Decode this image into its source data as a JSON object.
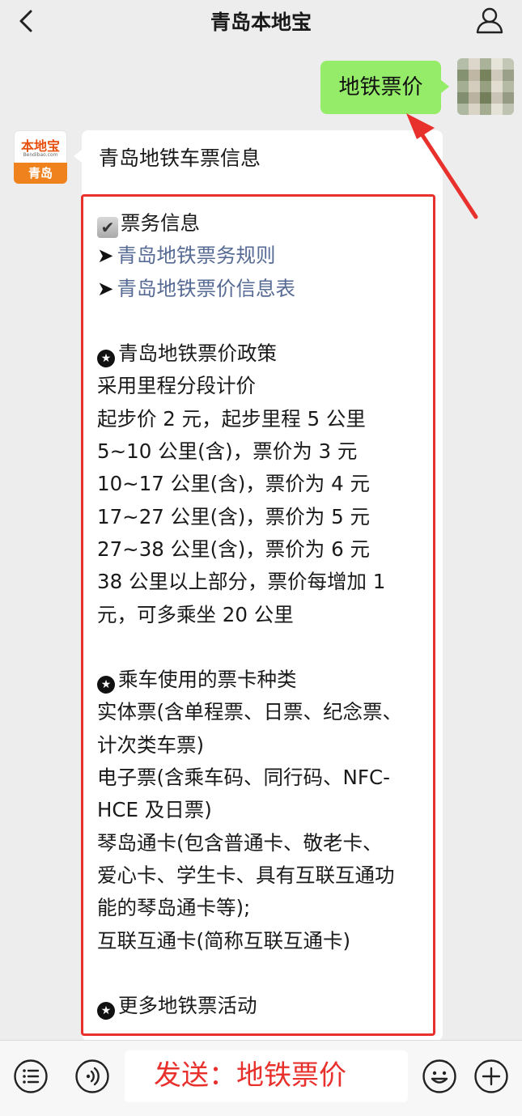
{
  "header": {
    "title": "青岛本地宝"
  },
  "user_message": {
    "text": "地铁票价"
  },
  "bot": {
    "avatar_brand": "本地宝",
    "avatar_domain": "Bendibao.com",
    "avatar_city": "青岛",
    "message_title": "青岛地铁车票信息",
    "lines": {
      "l0": "票务信息",
      "l1": "青岛地铁票务规则",
      "l2": "青岛地铁票价信息表",
      "l4": "青岛地铁票价政策",
      "l5": "采用里程分段计价",
      "l6": "起步价 2 元，起步里程 5 公里",
      "l7": "5~10 公里(含)，票价为 3 元",
      "l8": "10~17 公里(含)，票价为 4 元",
      "l9": "17~27 公里(含)，票价为 5 元",
      "l10": "27~38 公里(含)，票价为 6 元",
      "l11": "38 公里以上部分，票价每增加 1",
      "l12": "元，可多乘坐 20 公里",
      "l14": "乘车使用的票卡种类",
      "l15": "实体票(含单程票、日票、纪念票、",
      "l16": "计次类车票)",
      "l17": "电子票(含乘车码、同行码、NFC-",
      "l18": "HCE 及日票)",
      "l19": "琴岛通卡(包含普通卡、敬老卡、",
      "l20": "爱心卡、学生卡、具有互联互通功",
      "l21": "能的琴岛通卡等);",
      "l22": "互联互通卡(简称互联互通卡)",
      "l24": "更多地铁票活动"
    }
  },
  "input_bar": {
    "text": "发送：地铁票价"
  },
  "icons": {
    "back": "chevron-left-icon",
    "profile": "person-icon",
    "menu": "list-menu-icon",
    "voice": "voice-icon",
    "emoji": "smiley-icon",
    "add": "plus-icon"
  },
  "colors": {
    "chat_bg": "#ededed",
    "user_bubble": "#95ec69",
    "link": "#576b95",
    "annotation_red": "#e8302c"
  }
}
